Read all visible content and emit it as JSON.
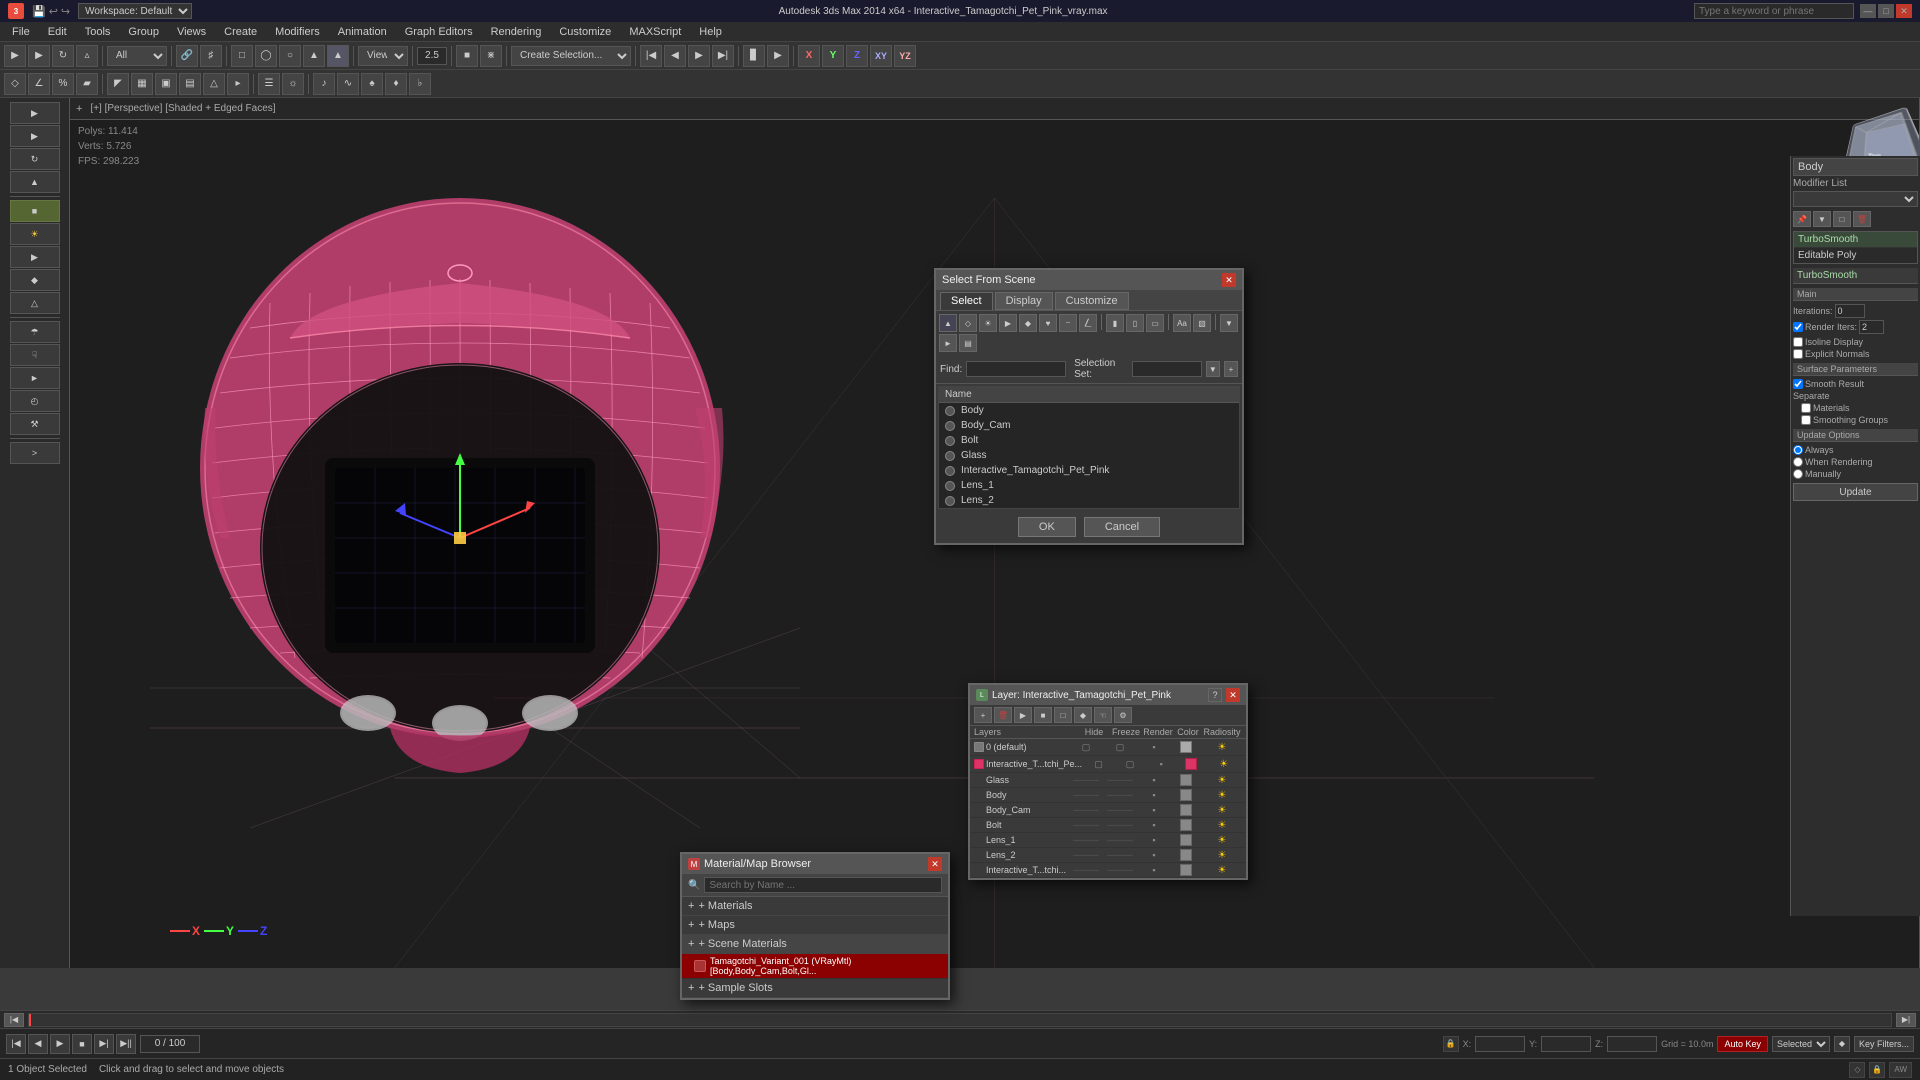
{
  "titlebar": {
    "title": "Autodesk 3ds Max 2014 x64 - Interactive_Tamagotchi_Pet_Pink_vray.max",
    "search_placeholder": "Type a keyword or phrase",
    "minimize": "—",
    "maximize": "□",
    "close": "✕"
  },
  "menubar": {
    "items": [
      "File",
      "Edit",
      "Tools",
      "Group",
      "Views",
      "Create",
      "Modifiers",
      "Animation",
      "Graph Editors",
      "Rendering",
      "Customize",
      "MAXScript",
      "Help"
    ]
  },
  "toolbar": {
    "mode": "All",
    "view_label": "View",
    "value_25": "2.5",
    "create_selection": "Create Selection..."
  },
  "viewport": {
    "label": "[+] [Perspective] [Shaded + Edged Faces]",
    "stats": {
      "polys_label": "Polys:",
      "polys_value": "11.414",
      "verts_label": "Verts:",
      "verts_value": "5.726",
      "fps_label": "FPS:",
      "fps_value": "298.223"
    }
  },
  "nav_cube": {
    "label": "ViewCube"
  },
  "select_from_scene": {
    "title": "Select From Scene",
    "tabs": [
      "Select",
      "Display",
      "Customize"
    ],
    "find_label": "Find:",
    "selection_set_label": "Selection Set:",
    "name_header": "Name",
    "objects": [
      "Body",
      "Body_Cam",
      "Bolt",
      "Glass",
      "Interactive_Tamagotchi_Pet_Pink",
      "Lens_1",
      "Lens_2"
    ],
    "ok_label": "OK",
    "cancel_label": "Cancel"
  },
  "material_browser": {
    "title": "Material/Map Browser",
    "search_placeholder": "Search by Name ...",
    "sections": [
      "+ Materials",
      "+ Maps",
      "+ Scene Materials",
      "+ Sample Slots"
    ],
    "scene_material": "Tamagotchi_Variant_001 (VRayMtl) [Body,Body_Cam,Bolt,Gl..."
  },
  "layer_dialog": {
    "title": "Layer: Interactive_Tamagotchi_Pet_Pink",
    "question_btn": "?",
    "close_btn": "✕",
    "columns": [
      "Layers",
      "Hide",
      "Freeze",
      "Render",
      "Color",
      "Radiosity"
    ],
    "rows": [
      {
        "name": "0 (default)",
        "hide": "",
        "freeze": "",
        "render": "",
        "color": "#aaaaaa",
        "radiosity": ""
      },
      {
        "name": "Interactive_T...tchi_Pe...",
        "hide": "",
        "freeze": "",
        "render": "",
        "color": "#dd3366",
        "radiosity": ""
      },
      {
        "name": "Glass",
        "hide": "",
        "freeze": "",
        "render": "",
        "color": "#aaaaaa",
        "radiosity": ""
      },
      {
        "name": "Body",
        "hide": "",
        "freeze": "",
        "render": "",
        "color": "#aaaaaa",
        "radiosity": ""
      },
      {
        "name": "Body_Cam",
        "hide": "",
        "freeze": "",
        "render": "",
        "color": "#aaaaaa",
        "radiosity": ""
      },
      {
        "name": "Bolt",
        "hide": "",
        "freeze": "",
        "render": "",
        "color": "#aaaaaa",
        "radiosity": ""
      },
      {
        "name": "Lens_1",
        "hide": "",
        "freeze": "",
        "render": "",
        "color": "#aaaaaa",
        "radiosity": ""
      },
      {
        "name": "Lens_2",
        "hide": "",
        "freeze": "",
        "render": "",
        "color": "#aaaaaa",
        "radiosity": ""
      },
      {
        "name": "Interactive_T...tchi...",
        "hide": "",
        "freeze": "",
        "render": "",
        "color": "#aaaaaa",
        "radiosity": ""
      }
    ]
  },
  "modifier_panel": {
    "title": "Body",
    "modifier_list_label": "Modifier List",
    "modifiers": [
      "TurboSmooth",
      "Editable Poly"
    ],
    "turbosmooth": {
      "main_label": "Main",
      "iterations_label": "Iterations:",
      "iterations_value": "0",
      "render_iters_label": "Render Iters:",
      "render_iters_value": "2",
      "render_iters_checked": true,
      "isoline_display_label": "Isoline Display",
      "explicit_normals_label": "Explicit Normals",
      "surface_params_label": "Surface Parameters",
      "smooth_result_label": "Smooth Result",
      "smooth_result_checked": true,
      "separate_label": "Separate",
      "materials_label": "Materials",
      "smoothing_groups_label": "Smoothing Groups",
      "update_options_label": "Update Options",
      "always_label": "Always",
      "always_selected": true,
      "when_rendering_label": "When Rendering",
      "manually_label": "Manually",
      "update_label": "Update"
    }
  },
  "bottom": {
    "object_selected": "1 Object Selected",
    "hint": "Click and drag to select and move objects",
    "x_label": "X:",
    "y_label": "Y:",
    "z_label": "Z:",
    "grid_label": "Grid = 10.0m",
    "auto_key_label": "Auto Key",
    "selected_label": "Selected",
    "time_value": "0 / 100",
    "key_filters_label": "Key Filters..."
  },
  "axis": {
    "x": "X",
    "y": "Y",
    "z": "Z",
    "xy": "XY",
    "yz": "YZ"
  }
}
